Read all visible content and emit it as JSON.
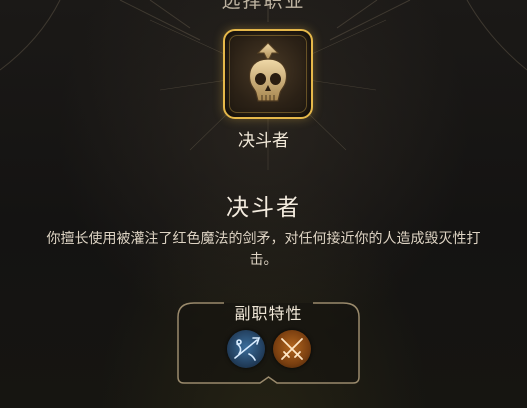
{
  "header": {
    "title": "选择职业"
  },
  "selected_class": {
    "portrait_label": "决斗者",
    "icon": "skull-emblem-icon",
    "frame_color": "#e6b84a"
  },
  "detail": {
    "name": "决斗者",
    "description": "你擅长使用被灌注了红色魔法的剑矛，对任何接近你的人造成毁灭性打击。"
  },
  "subclass_traits": {
    "title": "副职特性",
    "traits": [
      {
        "icon": "blue-spear-trait-icon",
        "color": "#3b6e9c"
      },
      {
        "icon": "crossed-swords-trait-icon",
        "color": "#b3661e"
      }
    ]
  }
}
